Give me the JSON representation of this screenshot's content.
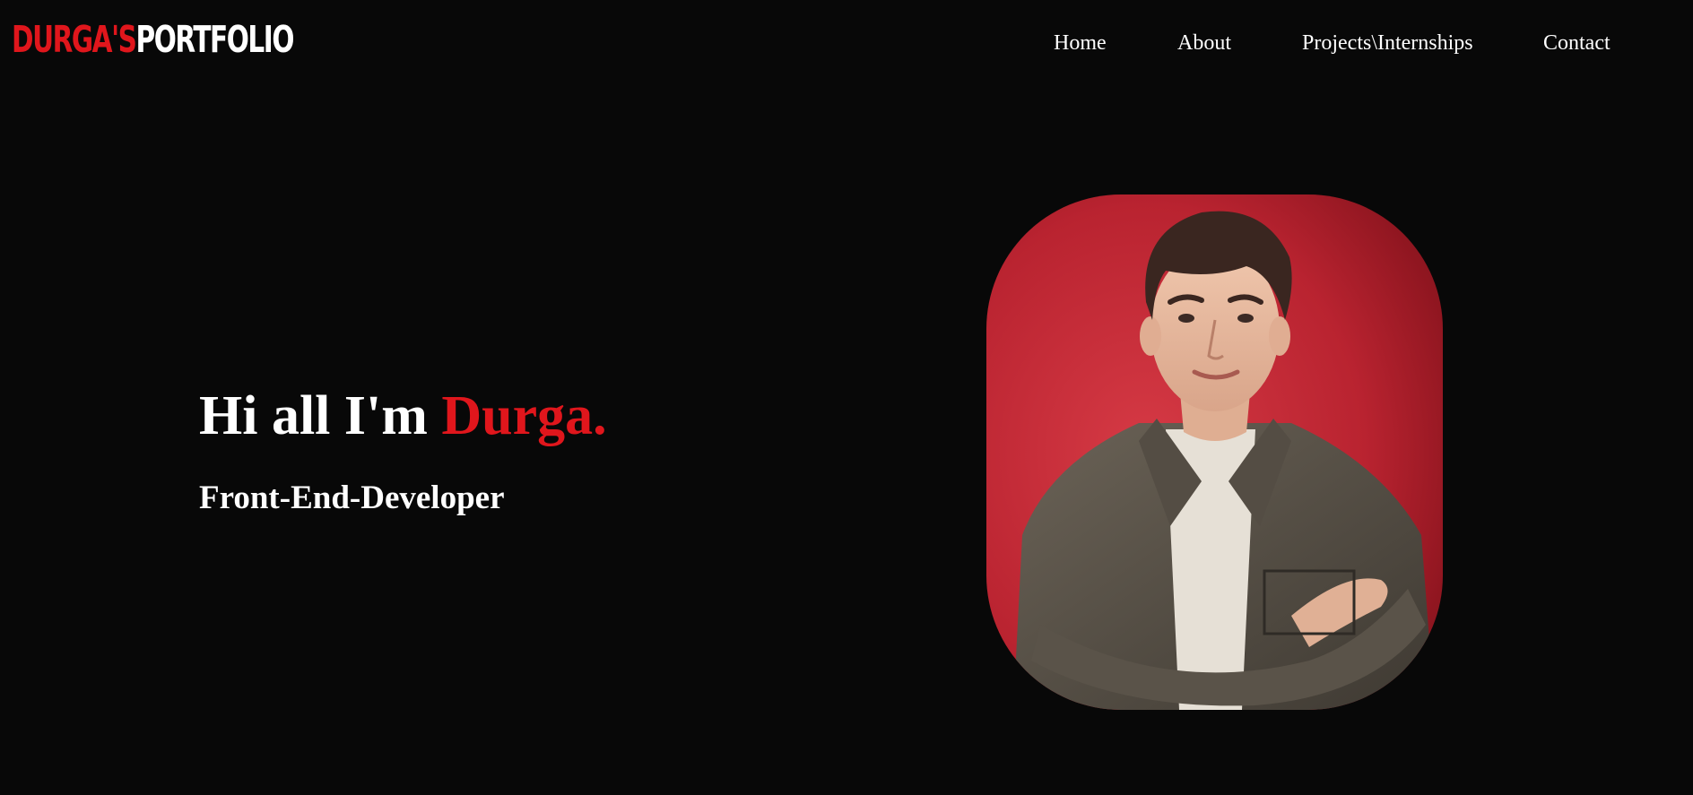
{
  "logo": {
    "first": "DURGA'S",
    "second": "PORTFOLIO"
  },
  "nav": {
    "home": "Home",
    "about": "About",
    "projects": "Projects\\Internships",
    "contact": "Contact"
  },
  "hero": {
    "greeting": "Hi all I'm ",
    "name": "Durga.",
    "subtitle": "Front-End-Developer"
  },
  "colors": {
    "background": "#080808",
    "accent": "#e0161c",
    "text": "#ffffff",
    "portrait_background": "#c42b33"
  }
}
